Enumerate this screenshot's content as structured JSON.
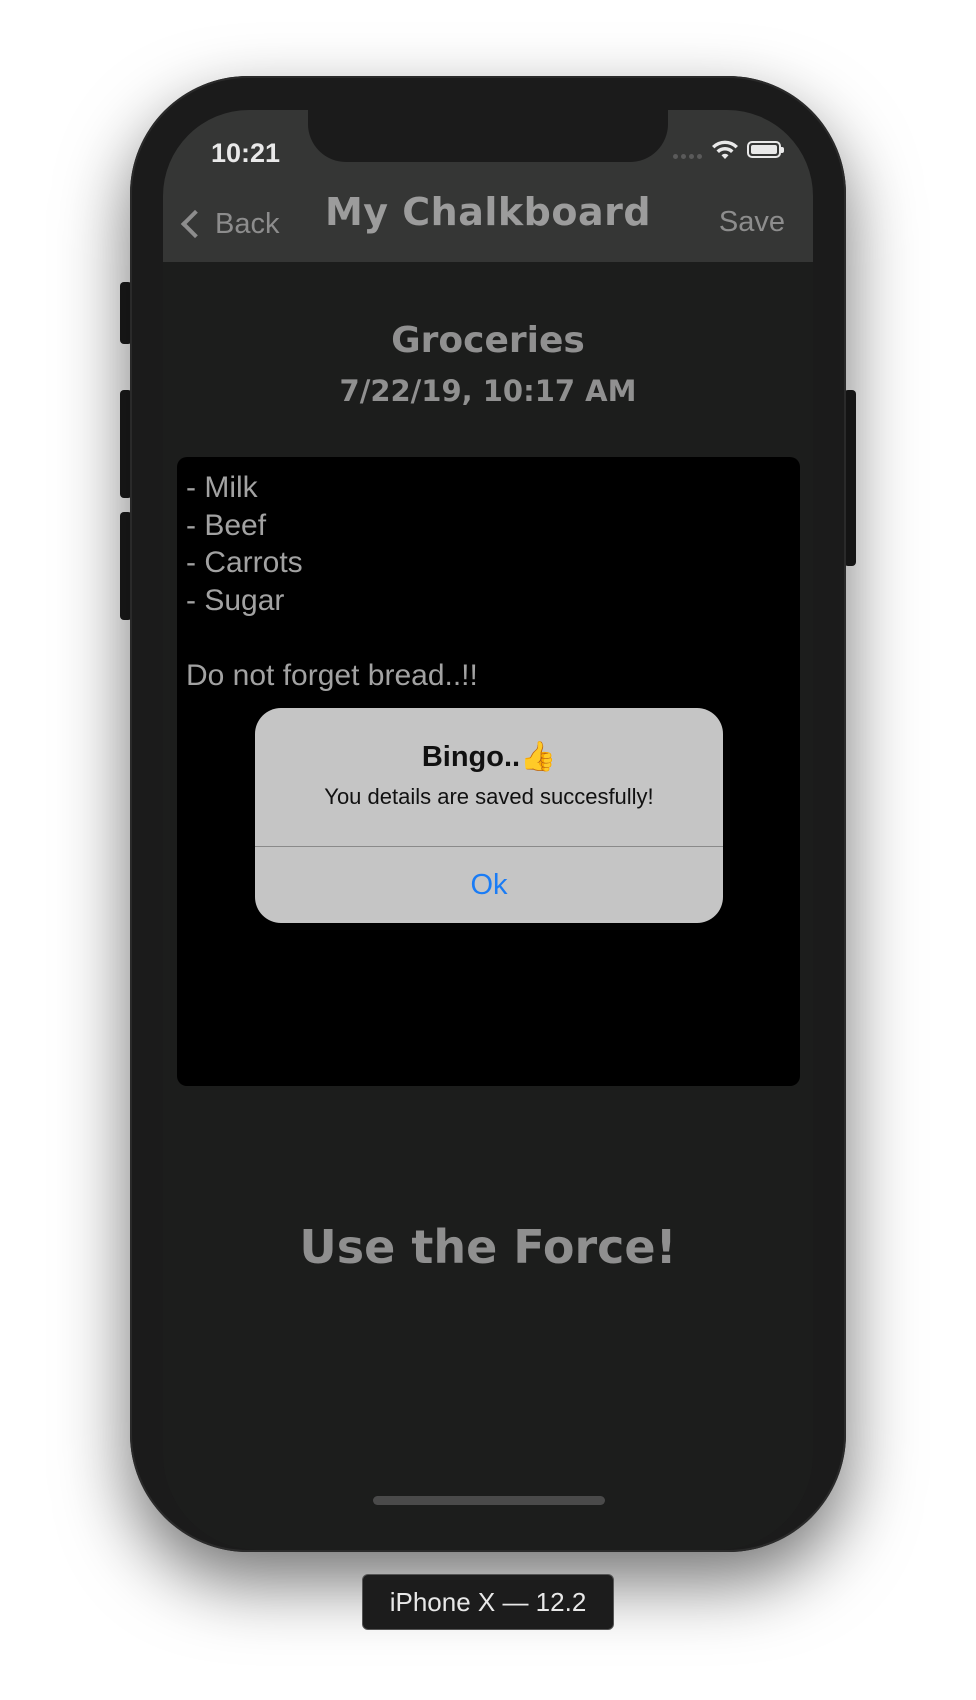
{
  "status_bar": {
    "time": "10:21"
  },
  "nav": {
    "back_label": "Back",
    "title": "My Chalkboard",
    "save_label": "Save"
  },
  "note": {
    "title": "Groceries",
    "date": "7/22/19, 10:17 AM",
    "body": "- Milk\n- Beef\n- Carrots\n- Sugar\n\nDo not forget bread..!!"
  },
  "footer": {
    "text": "Use the Force!"
  },
  "alert": {
    "title": "Bingo..👍",
    "message": "You details are saved succesfully!",
    "ok_label": "Ok"
  },
  "device": {
    "caption": "iPhone X — 12.2"
  },
  "colors": {
    "nav_background": "#353635",
    "screen_background": "#1c1d1c",
    "note_background": "#000000",
    "alert_background": "#c5c5c5",
    "alert_action": "#1a7cf5"
  },
  "icons": {
    "back": "chevron-left-icon",
    "wifi": "wifi-icon",
    "battery": "battery-icon",
    "signal": "signal-icon"
  }
}
